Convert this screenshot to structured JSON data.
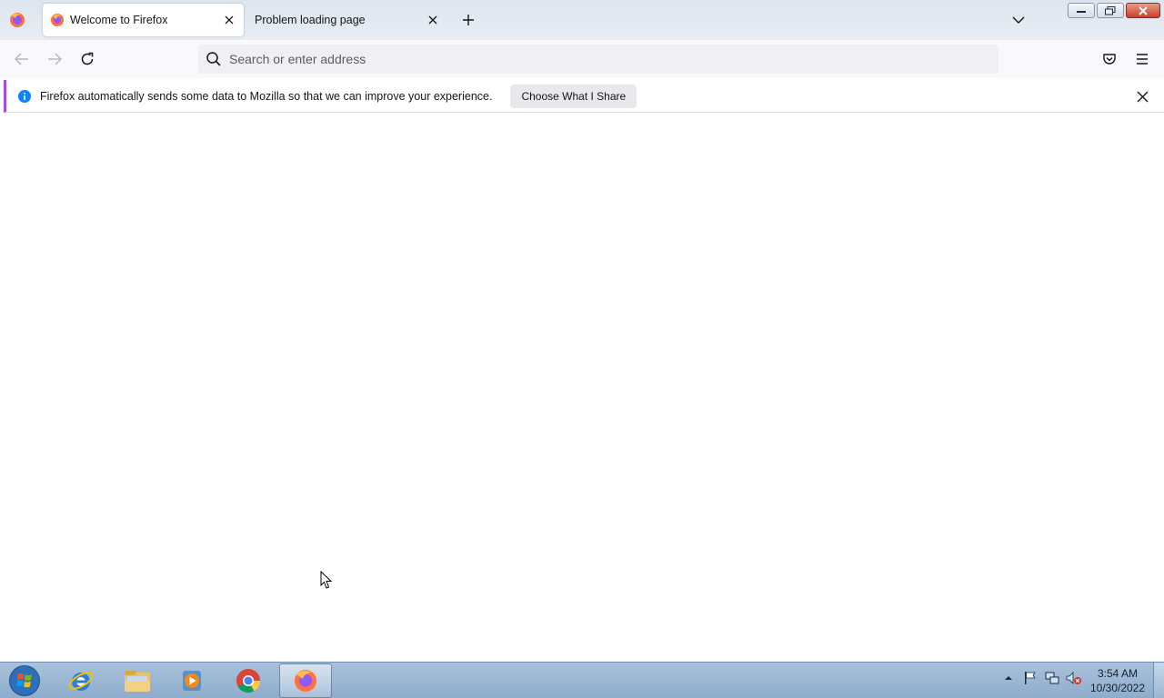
{
  "tabs": [
    {
      "label": "Welcome to Firefox",
      "active": true
    },
    {
      "label": "Problem loading page",
      "active": false
    }
  ],
  "toolbar": {
    "url_placeholder": "Search or enter address"
  },
  "notification": {
    "message": "Firefox automatically sends some data to Mozilla so that we can improve your experience.",
    "button_label": "Choose What I Share"
  },
  "taskbar": {
    "apps": [
      "internet-explorer",
      "file-explorer",
      "media-player",
      "chrome",
      "firefox"
    ],
    "active_app": "firefox",
    "clock_time": "3:54 AM",
    "clock_date": "10/30/2022"
  },
  "colors": {
    "notification_accent": "#a44dd9",
    "info_blue": "#0a84ff",
    "taskbar": "#9fbad6"
  }
}
